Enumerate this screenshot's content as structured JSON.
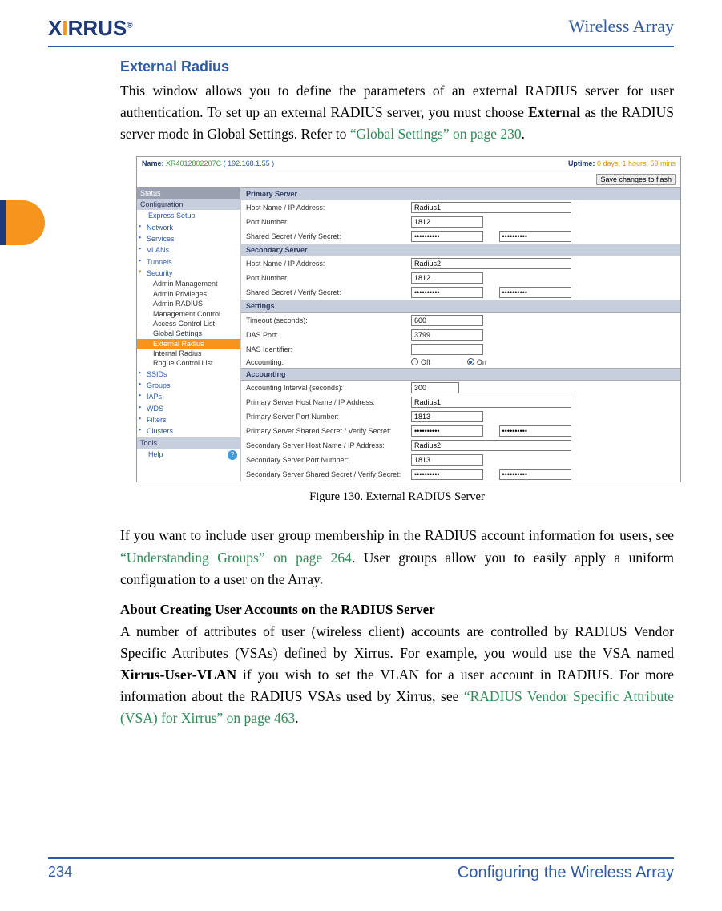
{
  "header": {
    "logo_text_pre": "X",
    "logo_text_mid": "I",
    "logo_text_post": "RRUS",
    "logo_reg": "®",
    "doc_right": "Wireless Array"
  },
  "page": {
    "number": "234",
    "footer_title": "Configuring the Wireless Array"
  },
  "section": {
    "title": "External Radius",
    "para1_a": "This window allows you to define the parameters of an external RADIUS server for user authentication. To set up an external RADIUS server, you must choose ",
    "para1_bold": "External",
    "para1_b": " as the RADIUS server mode in Global Settings. Refer to ",
    "para1_link": "“Global Settings” on page 230",
    "para1_c": ".",
    "fig_caption": "Figure 130. External RADIUS Server",
    "para2_a": "If you want to include user group membership in the RADIUS account information for users, see ",
    "para2_link": "“Understanding Groups” on page 264",
    "para2_b": ". User groups allow you to easily apply a uniform configuration to a user on the Array.",
    "sub_title": "About Creating User Accounts on the RADIUS Server",
    "para3_a": "A number of attributes of user (wireless client) accounts are controlled by RADIUS Vendor Specific Attributes (VSAs) defined by Xirrus. For example, you would use the VSA named ",
    "para3_bold": "Xirrus-User-VLAN",
    "para3_b": " if you wish to set the VLAN for a user account in RADIUS. For more information about the RADIUS VSAs used by Xirrus, see ",
    "para3_link": "“RADIUS Vendor Specific Attribute (VSA) for Xirrus” on page 463",
    "para3_c": "."
  },
  "shot": {
    "name_lbl": "Name: ",
    "name_val": "XR4012802207C",
    "name_ip": "( 192.168.1.55 )",
    "uptime_lbl": "Uptime: ",
    "uptime_val": "0 days, 1 hours, 59 mins",
    "save_btn": "Save changes to flash",
    "nav": {
      "status": "Status",
      "config": "Configuration",
      "express": "Express Setup",
      "network": "Network",
      "services": "Services",
      "vlans": "VLANs",
      "tunnels": "Tunnels",
      "security": "Security",
      "sec_items": [
        "Admin Management",
        "Admin Privileges",
        "Admin RADIUS",
        "Management Control",
        "Access Control List",
        "Global Settings",
        "External Radius",
        "Internal Radius",
        "Rogue Control List"
      ],
      "ssids": "SSIDs",
      "groups": "Groups",
      "iaps": "IAPs",
      "wds": "WDS",
      "filters": "Filters",
      "clusters": "Clusters",
      "tools": "Tools",
      "help": "Help"
    },
    "sections": {
      "primary": "Primary Server",
      "secondary": "Secondary Server",
      "settings": "Settings",
      "accounting": "Accounting"
    },
    "labels": {
      "host": "Host Name / IP Address:",
      "port": "Port Number:",
      "secret": "Shared Secret / Verify Secret:",
      "timeout": "Timeout (seconds):",
      "das": "DAS Port:",
      "nas": "NAS Identifier:",
      "acct": "Accounting:",
      "off": "Off",
      "on": "On",
      "acct_int": "Accounting Interval (seconds):",
      "p_host": "Primary Server Host Name / IP Address:",
      "p_port": "Primary Server Port Number:",
      "p_secret": "Primary Server Shared Secret / Verify Secret:",
      "s_host": "Secondary Server Host Name / IP Address:",
      "s_port": "Secondary Server Port Number:",
      "s_secret": "Secondary Server Shared Secret / Verify Secret:"
    },
    "values": {
      "p_host": "Radius1",
      "p_port": "1812",
      "secret": "••••••••••",
      "s_host": "Radius2",
      "s_port": "1812",
      "timeout": "600",
      "das": "3799",
      "nas": "",
      "acct_int": "300",
      "ap_host": "Radius1",
      "ap_port": "1813",
      "as_host": "Radius2",
      "as_port": "1813"
    }
  }
}
